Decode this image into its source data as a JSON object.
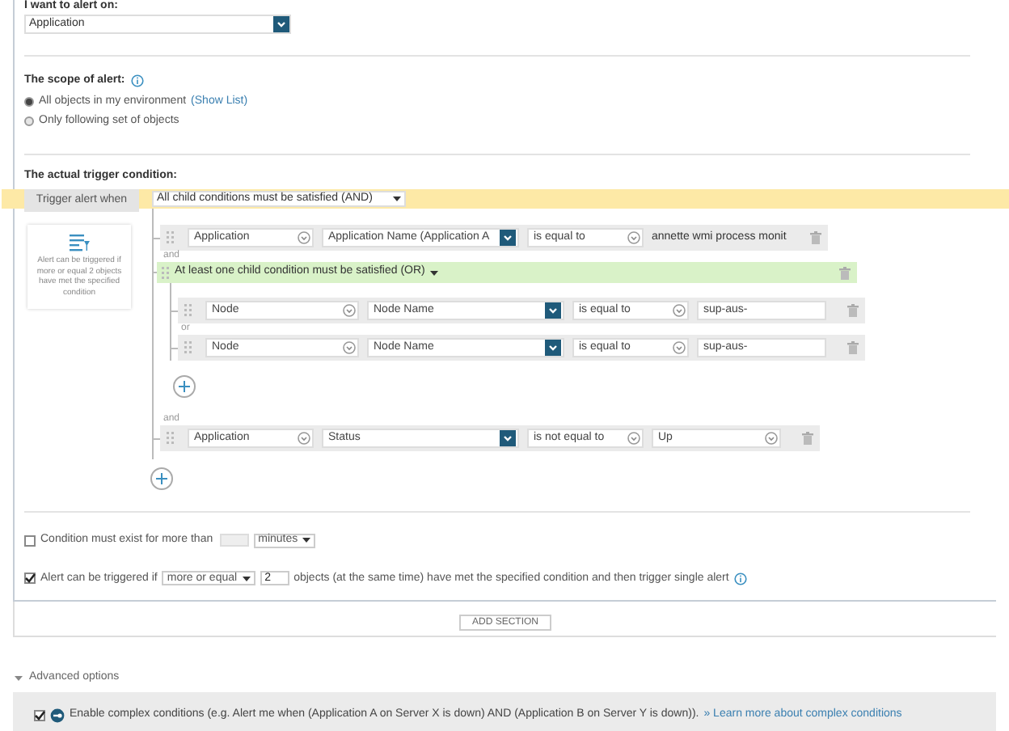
{
  "alert_on": {
    "label": "I want to alert on:",
    "value": "Application"
  },
  "scope": {
    "title": "The scope of alert:",
    "options": [
      {
        "label": "All objects in my environment",
        "link": "(Show List)",
        "selected": true
      },
      {
        "label": "Only following set of objects",
        "selected": false
      }
    ]
  },
  "trigger": {
    "title": "The actual trigger condition:",
    "when_label": "Trigger alert when",
    "summary": "Alert can be triggered if more or equal 2 objects have met the specified condition",
    "root": {
      "operator": "All child conditions must be satisfied (AND)",
      "children": [
        {
          "kind": "condition",
          "object": "Application",
          "field": "Application Name (Application A",
          "operator": "is equal to",
          "value": {
            "kind": "text",
            "text": "annette wmi process monit"
          }
        },
        {
          "kind": "group",
          "joiner": "and",
          "operator": "At least one child condition must be satisfied (OR)",
          "children": [
            {
              "kind": "condition",
              "object": "Node",
              "field": "Node Name",
              "operator": "is equal to",
              "value": {
                "kind": "field",
                "text": "sup-aus-"
              }
            },
            {
              "kind": "condition",
              "joiner": "or",
              "object": "Node",
              "field": "Node Name",
              "operator": "is equal to",
              "value": {
                "kind": "field",
                "text": "sup-aus-"
              }
            }
          ]
        },
        {
          "kind": "condition",
          "joiner": "and",
          "object": "Application",
          "field": "Status",
          "operator": "is not equal to",
          "value": {
            "kind": "select",
            "text": "Up"
          }
        }
      ]
    }
  },
  "duration": {
    "checked": false,
    "label": "Condition must exist for more than",
    "unit": "minutes"
  },
  "count": {
    "checked": true,
    "prefix": "Alert can be triggered if",
    "comparator": "more or equal",
    "number": "2",
    "suffix": "objects (at the same time) have met the specified condition and then trigger single alert"
  },
  "add_section": "ADD SECTION",
  "advanced": {
    "label": "Advanced options",
    "expanded": true,
    "complex": {
      "checked": true,
      "text": "Enable complex conditions (e.g. Alert me when (Application A on Server X is down) AND (Application B on Server Y is down)).",
      "link": "» Learn more about complex conditions"
    }
  }
}
